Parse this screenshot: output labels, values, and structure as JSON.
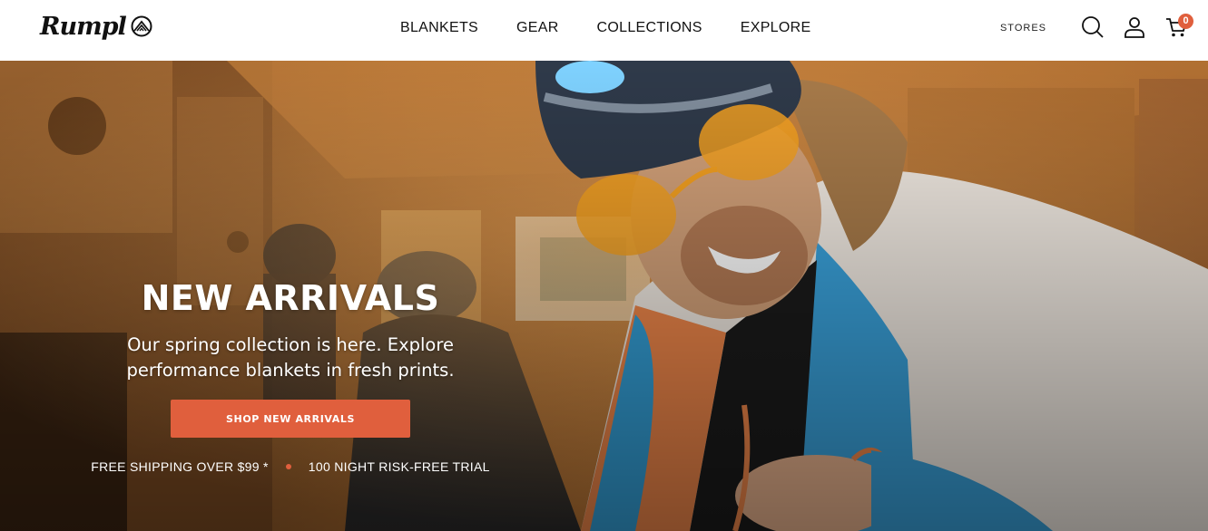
{
  "brand": {
    "name": "Rumpl"
  },
  "nav": {
    "items": [
      {
        "label": "BLANKETS"
      },
      {
        "label": "GEAR"
      },
      {
        "label": "COLLECTIONS"
      },
      {
        "label": "EXPLORE"
      }
    ]
  },
  "utils": {
    "stores_label": "STORES",
    "search_icon": "search-icon",
    "account_icon": "user-icon",
    "cart_icon": "cart-icon",
    "cart_count": "0"
  },
  "hero": {
    "title": "NEW ARRIVALS",
    "subtitle": "Our spring collection is here. Explore performance blankets in fresh prints.",
    "cta_label": "SHOP NEW ARRIVALS",
    "perks": [
      "FREE SHIPPING OVER $99 *",
      "100 NIGHT RISK-FREE TRIAL"
    ]
  },
  "colors": {
    "accent": "#e05f3d",
    "header_bg": "#ffffff",
    "text": "#111111"
  }
}
